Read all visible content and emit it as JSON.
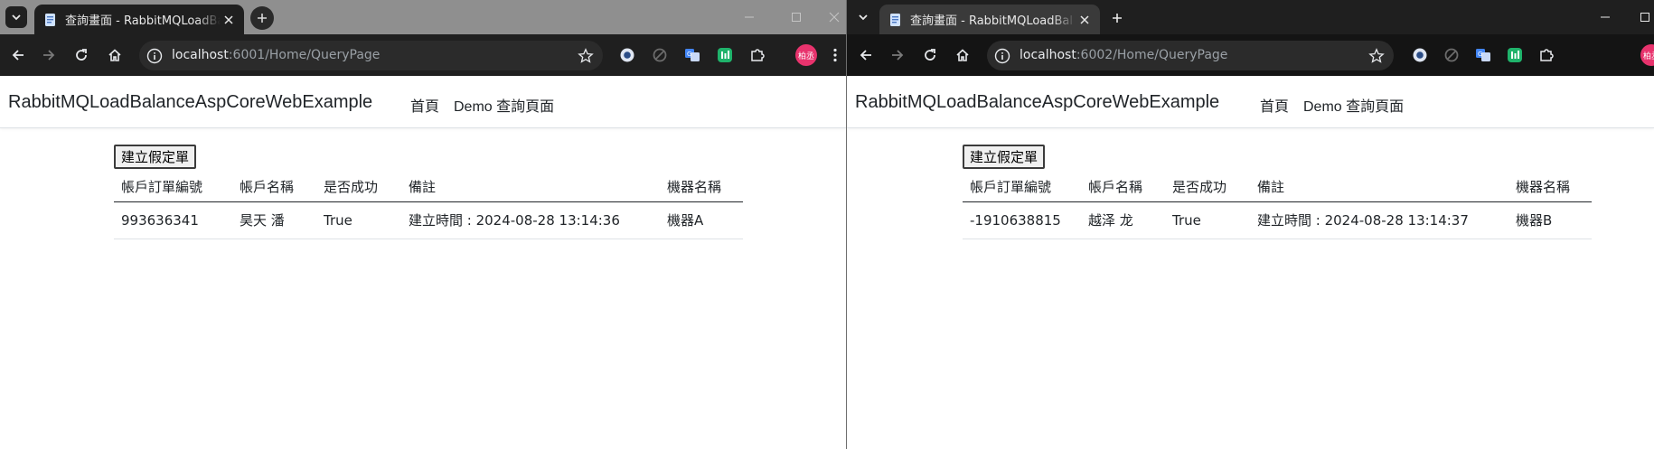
{
  "windows": [
    {
      "tab_title": "查詢畫面 - RabbitMQLoadBal",
      "url_host": "localhost",
      "url_rest": ":6001/Home/QueryPage",
      "profile_label": "柏丞",
      "page": {
        "brand": "RabbitMQLoadBalanceAspCoreWebExample",
        "nav": [
          "首頁",
          "Demo 查詢頁面"
        ],
        "create_button": "建立假定單",
        "columns": [
          "帳戶訂單編號",
          "帳戶名稱",
          "是否成功",
          "備註",
          "機器名稱"
        ],
        "rows": [
          [
            "993636341",
            "昊天 潘",
            "True",
            "建立時間 : 2024-08-28 13:14:36",
            "機器A"
          ]
        ]
      }
    },
    {
      "tab_title": "查詢畫面 - RabbitMQLoadBal",
      "url_host": "localhost",
      "url_rest": ":6002/Home/QueryPage",
      "profile_label": "柏丞",
      "page": {
        "brand": "RabbitMQLoadBalanceAspCoreWebExample",
        "nav": [
          "首頁",
          "Demo 查詢頁面"
        ],
        "create_button": "建立假定單",
        "columns": [
          "帳戶訂單編號",
          "帳戶名稱",
          "是否成功",
          "備註",
          "機器名稱"
        ],
        "rows": [
          [
            "-1910638815",
            "越泽 龙",
            "True",
            "建立時間 : 2024-08-28 13:14:37",
            "機器B"
          ]
        ]
      }
    }
  ],
  "icons": {
    "tab_favicon": "page-icon",
    "tab_close": "close-icon",
    "new_tab": "plus-icon",
    "tab_search": "chevron-down-icon",
    "back": "back-arrow-icon",
    "forward": "forward-arrow-icon",
    "reload": "reload-icon",
    "home": "home-icon",
    "site_info": "site-info-icon",
    "bookmark": "star-icon",
    "extensions": [
      "extension-circle-icon",
      "extension-sync-icon",
      "translate-icon",
      "extension-green-icon",
      "puzzle-icon"
    ],
    "menu": "kebab-menu-icon"
  },
  "colors": {
    "chrome_dark": "#1f1f1f",
    "chrome_inactive": "#8f8f8f",
    "page_text": "#212529",
    "profile": "#e8336d"
  }
}
